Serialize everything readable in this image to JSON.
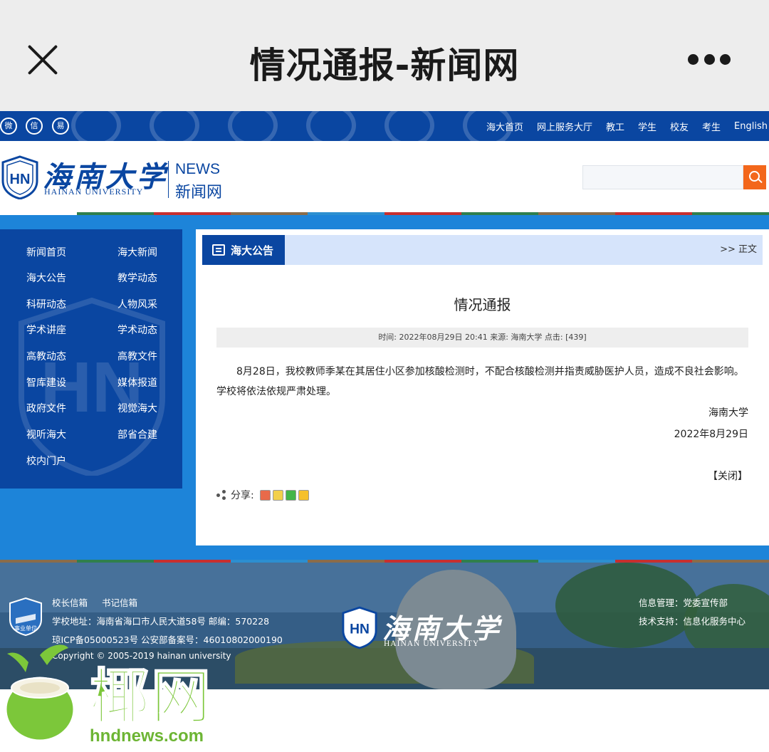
{
  "app": {
    "title": "情况通报-新闻网"
  },
  "topbar": {
    "social": [
      "weibo-icon",
      "wechat-icon",
      "yiban-icon"
    ],
    "social_glyphs": [
      "微",
      "信",
      "易"
    ],
    "links": [
      "海大首页",
      "网上服务大厅",
      "教工",
      "学生",
      "校友",
      "考生",
      "English"
    ]
  },
  "logo": {
    "emblem_letters": "HN",
    "cn": "海南大学",
    "en": "HAINAN UNIVERSITY",
    "news_en": "NEWS",
    "news_cn": "新闻网"
  },
  "search": {
    "placeholder": ""
  },
  "sidebar": {
    "items": [
      "新闻首页",
      "海大新闻",
      "海大公告",
      "教学动态",
      "科研动态",
      "人物风采",
      "学术讲座",
      "学术动态",
      "高教动态",
      "高教文件",
      "智库建设",
      "媒体报道",
      "政府文件",
      "视觉海大",
      "视听海大",
      "部省合建",
      "校内门户"
    ]
  },
  "crumb": {
    "section": "海大公告",
    "path": ">> 正文"
  },
  "article": {
    "title": "情况通报",
    "meta": "时间: 2022年08月29日 20:41    来源: 海南大学 点击: [439]",
    "body": "8月28日，我校教师季某在其居住小区参加核酸检测时，不配合核酸检测并指责威胁医护人员，造成不良社会影响。学校将依法依规严肃处理。",
    "signature": "海南大学",
    "date": "2022年8月29日",
    "close_label": "【关闭】",
    "share_label": "分享:",
    "share_icons": [
      "weibo-share-icon",
      "qq-share-icon",
      "wechat-share-icon",
      "qzone-share-icon"
    ]
  },
  "footer": {
    "badge": "事业单位",
    "links": [
      "校长信箱",
      "书记信箱"
    ],
    "address": "学校地址：海南省海口市人民大道58号    邮编：570228",
    "icp": "琼ICP备05000523号    公安部备案号：46010802000190",
    "copyright": "Copyright © 2005-2019 hainan university",
    "info_mgmt": "信息管理：党委宣传部",
    "tech_support": "技术支持：信息化服务中心",
    "logo_cn": "海南大学",
    "logo_en": "HAINAN UNIVERSITY"
  },
  "watermark": {
    "text": "椰网",
    "url": "hndnews.com"
  },
  "colors": {
    "brand_blue": "#0a46a1",
    "main_blue": "#1d84d9",
    "search_orange": "#f3671b",
    "watermark_green": "#7cc73a"
  }
}
